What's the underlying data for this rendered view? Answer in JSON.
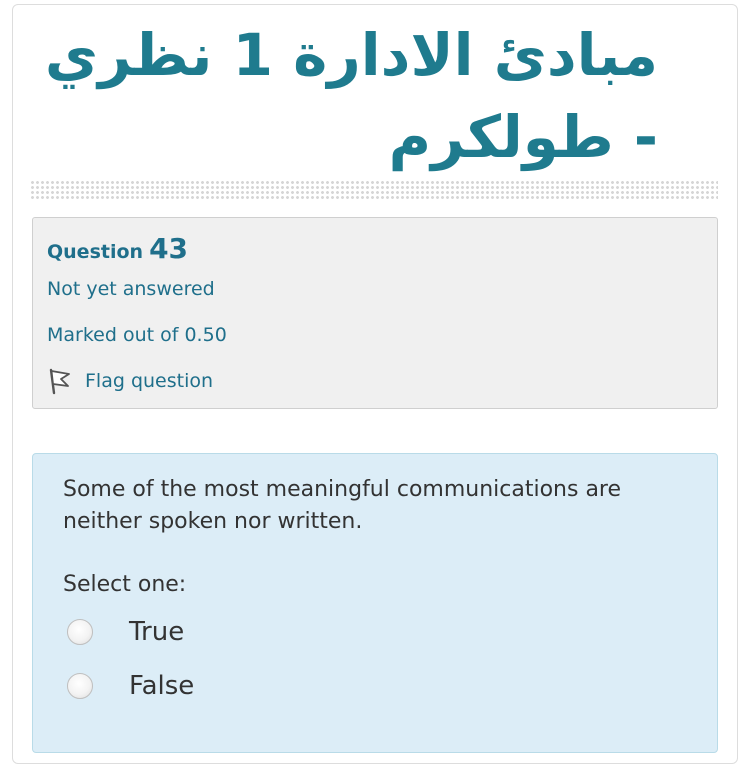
{
  "course": {
    "title": "مبادئ الادارة 1 نظري - طولكرم"
  },
  "question_info": {
    "label": "Question",
    "number": "43",
    "status": "Not yet answered",
    "marks": "Marked out of 0.50",
    "flag_label": "Flag question",
    "flag_icon": "flag-icon"
  },
  "question": {
    "text": "Some of the most meaningful communications are neither spoken nor written.",
    "prompt": "Select one:",
    "options": [
      {
        "label": "True",
        "selected": false
      },
      {
        "label": "False",
        "selected": false
      }
    ]
  },
  "colors": {
    "accent": "#1f7b8e",
    "link": "#1f6f8b",
    "info_background": "#f0f0f0",
    "question_background": "#dcedf7"
  }
}
